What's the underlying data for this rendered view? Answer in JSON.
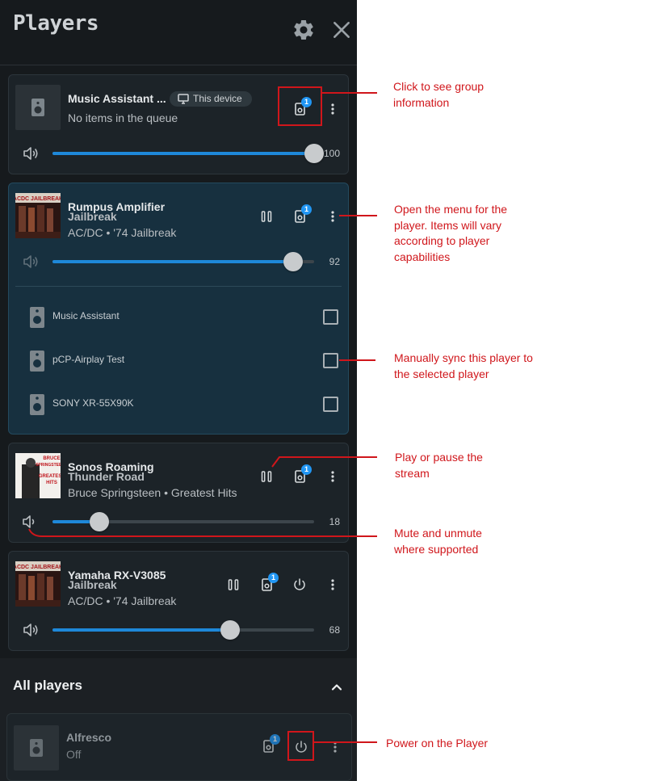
{
  "header": {
    "title": "Players",
    "settings_icon": "gear-icon",
    "close_icon": "close-icon"
  },
  "players": [
    {
      "name": "Music Assistant ...",
      "device_chip": "This device",
      "status": "No items in the queue",
      "group_badge": "1",
      "volume": 100,
      "volume_label": "100"
    },
    {
      "name": "Rumpus Amplifier",
      "track": "Jailbreak",
      "artist_album": "AC/DC • '74 Jailbreak",
      "group_badge": "1",
      "volume": 92,
      "volume_label": "92",
      "sync_targets": [
        {
          "label": "Music Assistant",
          "checked": false
        },
        {
          "label": "pCP-Airplay Test",
          "checked": false
        },
        {
          "label": "SONY XR-55X90K",
          "checked": false
        }
      ]
    },
    {
      "name": "Sonos Roaming",
      "track": "Thunder Road",
      "artist_album": "Bruce Springsteen • Greatest Hits",
      "group_badge": "1",
      "volume": 18,
      "volume_label": "18"
    },
    {
      "name": "Yamaha RX-V3085",
      "track": "Jailbreak",
      "artist_album": "AC/DC • '74 Jailbreak",
      "group_badge": "1",
      "volume": 68,
      "volume_label": "68"
    }
  ],
  "all_players": {
    "title": "All players",
    "items": [
      {
        "name": "Alfresco",
        "status": "Off",
        "group_badge": "1"
      }
    ]
  },
  "annotations": {
    "group_info": "Click to see group information",
    "menu": "Open the menu for the player. Items will vary according to player capabilities",
    "sync": "Manually sync this player to the selected player",
    "play_pause": "Play or pause the stream",
    "mute": "Mute and unmute where supported",
    "power": "Power on the Player"
  },
  "colors": {
    "accent": "#1e88d9",
    "annotation": "#d0161b",
    "badge": "#2196f3"
  }
}
